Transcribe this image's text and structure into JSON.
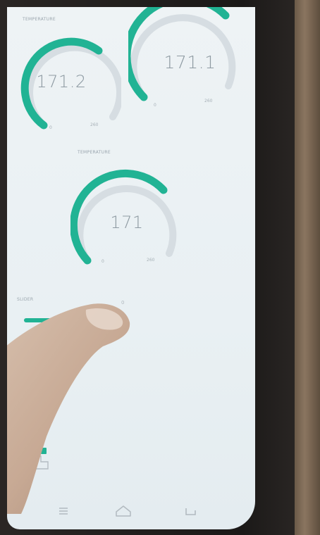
{
  "gauges": [
    {
      "id": "g1",
      "caption": "TEMPERATURE",
      "value": "171.2",
      "min": "0",
      "max": "260",
      "level": 0.66
    },
    {
      "id": "g2",
      "caption": "",
      "value": "171.1",
      "min": "0",
      "max": "260",
      "level": 0.66
    },
    {
      "id": "g3",
      "caption": "TEMPERATURE",
      "value": "171",
      "min": "0",
      "max": "260",
      "level": 0.66
    }
  ],
  "slider": {
    "caption": "SLIDER",
    "max": "0",
    "level": 0.58
  },
  "colors": {
    "accent": "#21b394",
    "track": "#d6dde2"
  },
  "nav": {
    "menu_icon": "menu-icon",
    "home_icon": "home-icon",
    "back_icon": "back-icon"
  }
}
